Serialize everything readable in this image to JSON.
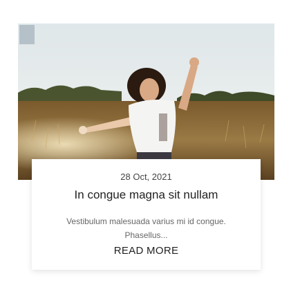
{
  "post": {
    "image_alt": "Young woman with raised arm in a wheat field",
    "date": "28 Oct, 2021",
    "title": "In congue magna sit nullam",
    "excerpt": "Vestibulum malesuada varius mi id congue. Phasellus...",
    "read_more_label": "READ MORE"
  },
  "colors": {
    "sky": "#e6ecee",
    "field": "#8c6b38",
    "trees": "#3e4a28",
    "text_dark": "#222222",
    "text_muted": "#666666"
  }
}
